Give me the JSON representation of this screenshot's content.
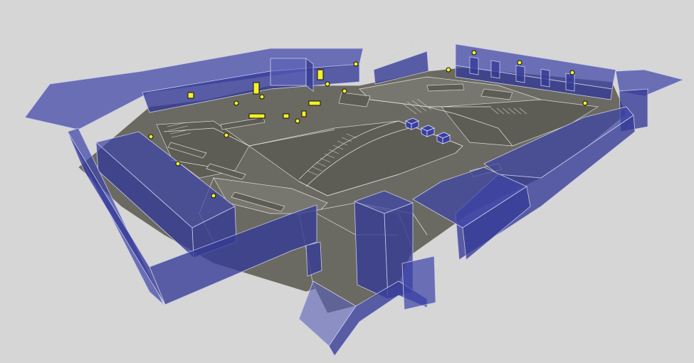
{
  "scene": {
    "background_color": "#d6d6d6",
    "wall_color": "#3f45a8",
    "floor_color": "#6a6a62",
    "highlight_color": "#f4f02a"
  },
  "markers": {
    "icon": "pickup-marker",
    "count": 22
  },
  "spawn_boxes": {
    "icon": "blue-cube",
    "count": 3
  }
}
